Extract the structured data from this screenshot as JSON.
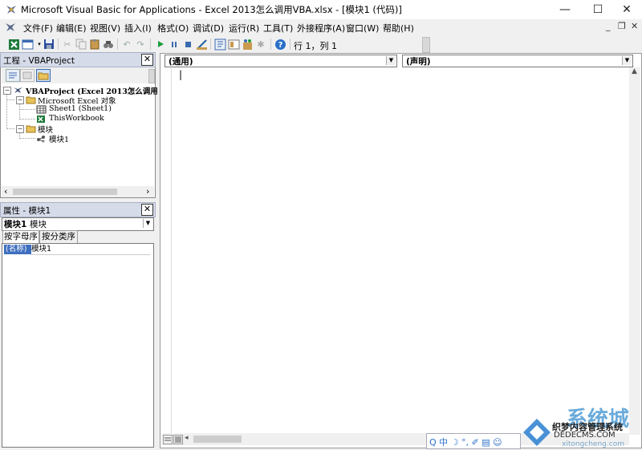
{
  "window": {
    "title": "Microsoft Visual Basic for Applications - Excel 2013怎么调用VBA.xlsx - [模块1 (代码)]",
    "minimize": "—",
    "maximize": "☐",
    "close": "✕"
  },
  "menu": {
    "items": [
      {
        "label": "文件(F)"
      },
      {
        "label": "编辑(E)"
      },
      {
        "label": "视图(V)"
      },
      {
        "label": "插入(I)"
      },
      {
        "label": "格式(O)"
      },
      {
        "label": "调试(D)"
      },
      {
        "label": "运行(R)"
      },
      {
        "label": "工具(T)"
      },
      {
        "label": "外接程序(A)"
      },
      {
        "label": "窗口(W)"
      },
      {
        "label": "帮助(H)"
      }
    ],
    "mdi_minimize": "_",
    "mdi_restore": "❐",
    "mdi_close": "✕"
  },
  "toolbar": {
    "position": "行 1，列 1"
  },
  "project": {
    "title": "工程 - VBAProject",
    "close": "✕",
    "tree": {
      "root": "VBAProject (Excel 2013怎么调用",
      "objects_folder": "Microsoft Excel 对象",
      "sheet1": "Sheet1 (Sheet1)",
      "workbook": "ThisWorkbook",
      "modules_folder": "模块",
      "module1": "模块1"
    },
    "scroll_left": "‹",
    "scroll_right": "›"
  },
  "properties": {
    "title": "属性 - 模块1",
    "close": "✕",
    "object_name": "模块1",
    "object_type": "模块",
    "tab_alpha": "按字母序",
    "tab_category": "按分类序",
    "row_name": "(名称)",
    "row_value": "模块1"
  },
  "code": {
    "object_combo": "(通用)",
    "proc_combo": "(声明)",
    "cursor": "|"
  },
  "watermark": {
    "ime": "Q 中 ☽ °, ✐ ▤ ☺",
    "site_big": "系统城",
    "line1": "织梦内容管理系统",
    "line2": "DEDECMS.COM",
    "line3": "xitongcheng.com"
  },
  "colors": {
    "panel_title_bg": "#d6dbe9",
    "selection": "#3f6fbf",
    "run_green": "#1a9b3a"
  }
}
